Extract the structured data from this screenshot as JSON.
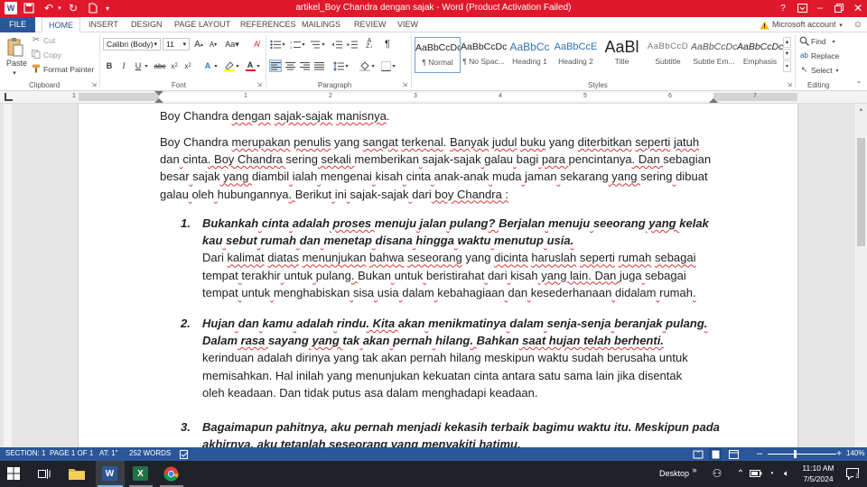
{
  "window": {
    "title": "artikel_Boy Chandra dengan sajak - Word (Product Activation Failed)",
    "help_glyph": "?",
    "account": "Microsoft account"
  },
  "ribbon_tabs": [
    "FILE",
    "HOME",
    "INSERT",
    "DESIGN",
    "PAGE LAYOUT",
    "REFERENCES",
    "MAILINGS",
    "REVIEW",
    "VIEW"
  ],
  "clipboard": {
    "paste": "Paste",
    "cut": "Cut",
    "copy": "Copy",
    "format_painter": "Format Painter",
    "label": "Clipboard"
  },
  "font": {
    "name": "Calibri (Body)",
    "size": "11",
    "label": "Font"
  },
  "paragraph": {
    "label": "Paragraph"
  },
  "styles": {
    "label": "Styles",
    "items": [
      {
        "preview": "AaBbCcDc",
        "name": "¶ Normal"
      },
      {
        "preview": "AaBbCcDc",
        "name": "¶ No Spac..."
      },
      {
        "preview": "AaBbCc",
        "name": "Heading 1"
      },
      {
        "preview": "AaBbCcE",
        "name": "Heading 2"
      },
      {
        "preview": "AaBl",
        "name": "Title"
      },
      {
        "preview": "AaBbCcD",
        "name": "Subtitle"
      },
      {
        "preview": "AaBbCcDc",
        "name": "Subtle Em..."
      },
      {
        "preview": "AaBbCcDc",
        "name": "Emphasis"
      }
    ]
  },
  "editing": {
    "find": "Find",
    "replace": "Replace",
    "select": "Select",
    "label": "Editing"
  },
  "ruler": {
    "numbers": [
      "1",
      "1",
      "2",
      "3",
      "4",
      "5",
      "6",
      "7"
    ]
  },
  "document": {
    "line0": [
      "Boy Chandra ",
      "dengan",
      " ",
      "sajak-sajak",
      " ",
      "manisnya",
      "."
    ],
    "para1": [
      [
        "Boy Chandra ",
        "merupakan",
        " ",
        "penulis",
        " yang ",
        "sangat",
        " ",
        "terkenal",
        ". ",
        "Banyak",
        " ",
        "judul",
        " ",
        "buku",
        " yang ",
        "diterbitkan",
        " ",
        "seperti",
        " ",
        "jatuh"
      ],
      [
        "dan",
        " ",
        "cinta",
        ". Boy Chandra ",
        "sering",
        " sekali ",
        "memberikan",
        " ",
        "sajak-sajak",
        " ",
        "galau",
        " ",
        "bagi",
        " para ",
        "pencintanya",
        ". Dan ",
        "sebagian"
      ],
      [
        "besar",
        " ",
        "sajak",
        " yang ",
        "diambil",
        " ",
        "ialah",
        " ",
        "mengenai",
        " ",
        "kisah",
        " ",
        "cinta",
        " ",
        "anak-anak",
        " ",
        "muda",
        " ",
        "jaman",
        " ",
        "sekarang",
        " yang ",
        "sering",
        " ",
        "dibuat"
      ],
      [
        "galau",
        " ",
        "oleh",
        " ",
        "hubungannya",
        ". ",
        "Berikut",
        " ",
        "ini",
        " ",
        "sajak-sajak",
        " ",
        "dari",
        " boy Chandra :"
      ]
    ],
    "items": [
      {
        "num": "1.",
        "bold_lines": [
          [
            "Bukankah",
            " ",
            "cinta",
            " ",
            "adalah",
            " proses ",
            "menuju",
            " ",
            "jalan",
            " ",
            "pulang",
            "? ",
            "Berjalan",
            " ",
            "menuju",
            " ",
            "seeorang",
            " yang ",
            "kelak"
          ],
          [
            "kau",
            " ",
            "sebut",
            " ",
            "rumah",
            " ",
            "dan",
            " ",
            "menetap",
            " ",
            "disana",
            " ",
            "hingga",
            " ",
            "waktu",
            " ",
            "menutup",
            " ",
            "usia",
            "."
          ]
        ],
        "body_lines": [
          [
            "Dari ",
            "kalimat",
            " ",
            "diatas",
            " ",
            "menunjukan",
            " ",
            "bahwa",
            " ",
            "seseorang",
            " yang ",
            "dicinta",
            " ",
            "haruslah",
            " ",
            "seperti",
            " ",
            "rumah",
            " ",
            "sebagai"
          ],
          [
            "tempat",
            " ",
            "terakhir",
            " ",
            "untuk",
            " ",
            "pulang",
            ". ",
            "Bukan",
            " ",
            "untuk",
            " ",
            "beristirahat",
            " ",
            "dari",
            " ",
            "kisah",
            " yang lain. Dan ",
            "juga",
            " ",
            "sebagai"
          ],
          [
            "tempat",
            " ",
            "untuk",
            " ",
            "menghabiskan",
            " ",
            "sisa",
            " ",
            "usia",
            " ",
            "dalam",
            " ",
            "kebahagiaan",
            " ",
            "dan",
            " ",
            "kesederhanaan",
            " ",
            "didalam",
            " ",
            "rumah",
            "."
          ]
        ]
      },
      {
        "num": "2.",
        "bold_lines": [
          [
            "Hujan",
            " ",
            "dan",
            " ",
            "kamu",
            " ",
            "adalah",
            " ",
            "rindu",
            ". Kita ",
            "akan",
            " ",
            "menikmatinya",
            " ",
            "dalam",
            " ",
            "senja-senja",
            " ",
            "beranjak",
            " ",
            "pulang",
            "."
          ],
          [
            "Dalam",
            " rasa ",
            "sayang",
            " yang ",
            "tak",
            " ",
            "akan",
            " ",
            "pernah",
            " ",
            "hilang",
            ". ",
            "Bahkan",
            " saat hujan telah berhenti."
          ]
        ],
        "body_lines": [
          [
            "kerinduan adalah dirinya yang tak akan pernah hilang meskipun waktu sudah berusaha untuk"
          ],
          [
            "memisahkan. Hal inilah yang menunjukan kekuatan cinta antara satu sama lain jika disentak"
          ],
          [
            "oleh keadaan. Dan tidak putus asa dalam menghadapi keadaan."
          ]
        ]
      },
      {
        "num": "3.",
        "bold_lines": [
          [
            "Bagaimapun pahitnya, aku pernah menjadi kekasih terbaik bagimu waktu itu. Meskipun pada"
          ],
          [
            "akhirnya, aku tetaplah seseorang yang menyakiti hatimu."
          ]
        ],
        "body_lines": []
      }
    ]
  },
  "status": {
    "section": "SECTION: 1",
    "page": "PAGE 1 OF 1",
    "at": "AT: 1\"",
    "words": "252 WORDS",
    "zoom": "140%",
    "zoom_level": 0.4
  },
  "taskbar": {
    "desktop": "Desktop",
    "time": "11:10 AM",
    "date": "7/5/2024",
    "notif_count": "3"
  }
}
